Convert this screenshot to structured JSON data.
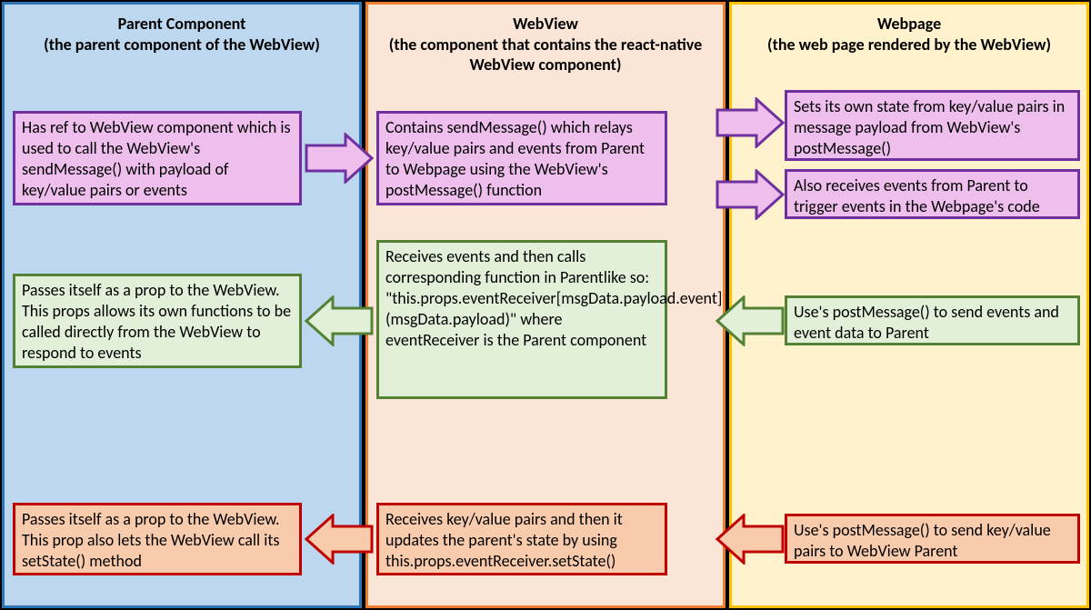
{
  "columns": {
    "parent": {
      "title": "Parent Component",
      "subtitle": "(the parent component of the WebView)",
      "bg": "#bdd7ee",
      "border": "#2e75b6"
    },
    "webview": {
      "title": "WebView",
      "subtitle": "(the component that contains the react-native WebView component)",
      "bg": "#fbe5d6",
      "border": "#ed7d31"
    },
    "webpage": {
      "title": "Webpage",
      "subtitle": "(the web page rendered by the WebView)",
      "bg": "#fff2cc",
      "border": "#ffc000"
    }
  },
  "rows": {
    "purple": {
      "fill": "#eebeed",
      "stroke": "#7030a0",
      "parent": "Has ref to WebView component which is used to call the WebView's sendMessage() with payload of key/value pairs or events",
      "webview": "Contains sendMessage() which relays key/value pairs and events from Parent to Webpage using the WebView's postMessage() function",
      "webpage_top": "Sets its own state from key/value pairs in message payload from WebView's postMessage()",
      "webpage_bottom": "Also receives events from Parent to trigger events in the Webpage's code"
    },
    "green": {
      "fill": "#e2f0d9",
      "stroke": "#548235",
      "parent": "Passes itself as a prop to the WebView. This props allows its own functions to be called directly from the WebView to respond to events",
      "webview": "Receives events and then calls corresponding function in Parentlike so: \"this.props.eventReceiver[msgData.payload.event](msgData.payload)\" where eventReceiver is the Parent component",
      "webpage": "Use's postMessage() to send events and event data to Parent"
    },
    "red": {
      "fill": "#f8cbad",
      "stroke": "#c00000",
      "parent": "Passes itself as a prop to the WebView. This prop also lets the WebView call its setState() method",
      "webview": "Receives key/value pairs and then it updates the parent's state by using this.props.eventReceiver.setState()",
      "webpage": "Use's postMessage() to send key/value pairs to WebView Parent"
    }
  }
}
